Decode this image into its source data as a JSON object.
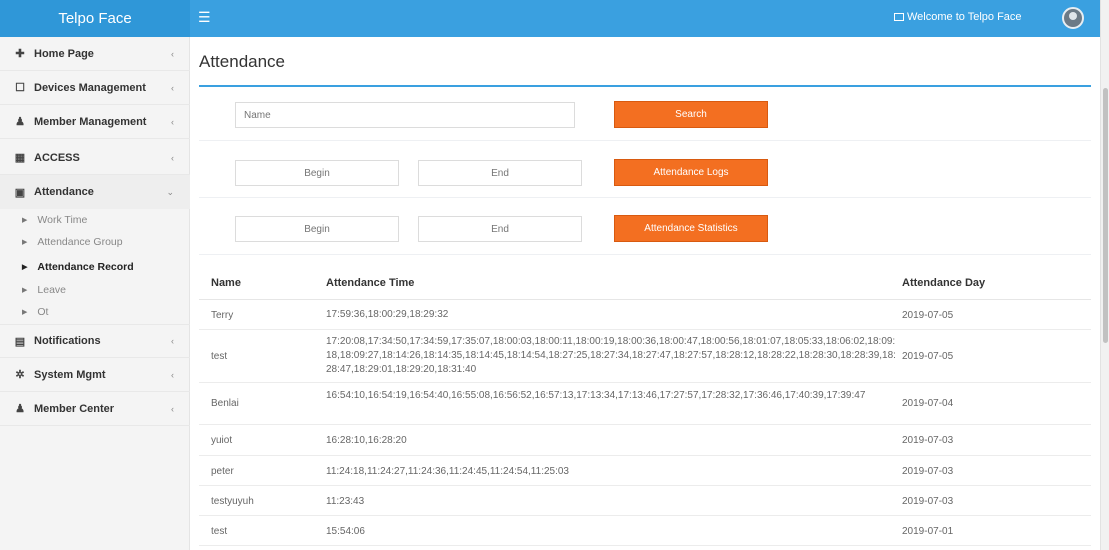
{
  "header": {
    "brand": "Telpo Face",
    "menu_icon": "☰",
    "welcome": "Welcome to Telpo Face"
  },
  "sidebar": {
    "items": [
      {
        "icon": "home-icon",
        "glyph": "✚",
        "label": "Home Page",
        "chevron": "‹"
      },
      {
        "icon": "square-icon",
        "glyph": "☐",
        "label": "Devices Management",
        "chevron": "‹"
      },
      {
        "icon": "user-icon",
        "glyph": "♟",
        "label": "Member Management",
        "chevron": "‹"
      },
      {
        "icon": "door-icon",
        "glyph": "▦",
        "label": "ACCESS",
        "chevron": "‹"
      },
      {
        "icon": "calendar-icon",
        "glyph": "▣",
        "label": "Attendance",
        "chevron": "⌄"
      }
    ],
    "sub_items": [
      {
        "label": "Work Time"
      },
      {
        "label": "Attendance Group"
      },
      {
        "label": "Attendance Record"
      },
      {
        "label": "Leave"
      },
      {
        "label": "Ot"
      }
    ],
    "lower_items": [
      {
        "icon": "document-icon",
        "glyph": "▤",
        "label": "Notifications",
        "chevron": "‹"
      },
      {
        "icon": "gear-icon",
        "glyph": "✲",
        "label": "System Mgmt",
        "chevron": "‹"
      },
      {
        "icon": "user-icon",
        "glyph": "♟",
        "label": "Member Center",
        "chevron": "‹"
      }
    ]
  },
  "main": {
    "title": "Attendance",
    "search": {
      "placeholder": "Name",
      "button": "Search"
    },
    "logs": {
      "begin_placeholder": "Begin",
      "end_placeholder": "End",
      "button": "Attendance Logs"
    },
    "stats": {
      "begin_placeholder": "Begin",
      "end_placeholder": "End",
      "button": "Attendance Statistics"
    },
    "table": {
      "columns": [
        "Name",
        "Attendance Time",
        "Attendance Day"
      ],
      "rows": [
        {
          "name": "Terry",
          "time": "17:59:36,18:00:29,18:29:32",
          "day": "2019-07-05"
        },
        {
          "name": "test",
          "time": "17:20:08,17:34:50,17:34:59,17:35:07,18:00:03,18:00:11,18:00:19,18:00:36,18:00:47,18:00:56,18:01:07,18:05:33,18:06:02,18:09:18,18:09:27,18:14:26,18:14:35,18:14:45,18:14:54,18:27:25,18:27:34,18:27:47,18:27:57,18:28:12,18:28:22,18:28:30,18:28:39,18:28:47,18:29:01,18:29:20,18:31:40",
          "day": "2019-07-05"
        },
        {
          "name": "Benlai",
          "time": "16:54:10,16:54:19,16:54:40,16:55:08,16:56:52,16:57:13,17:13:34,17:13:46,17:27:57,17:28:32,17:36:46,17:40:39,17:39:47",
          "day": "2019-07-04"
        },
        {
          "name": "yuiot",
          "time": "16:28:10,16:28:20",
          "day": "2019-07-03"
        },
        {
          "name": "peter",
          "time": "11:24:18,11:24:27,11:24:36,11:24:45,11:24:54,11:25:03",
          "day": "2019-07-03"
        },
        {
          "name": "testyuyuh",
          "time": "11:23:43",
          "day": "2019-07-03"
        },
        {
          "name": "test",
          "time": "15:54:06",
          "day": "2019-07-01"
        }
      ]
    }
  }
}
